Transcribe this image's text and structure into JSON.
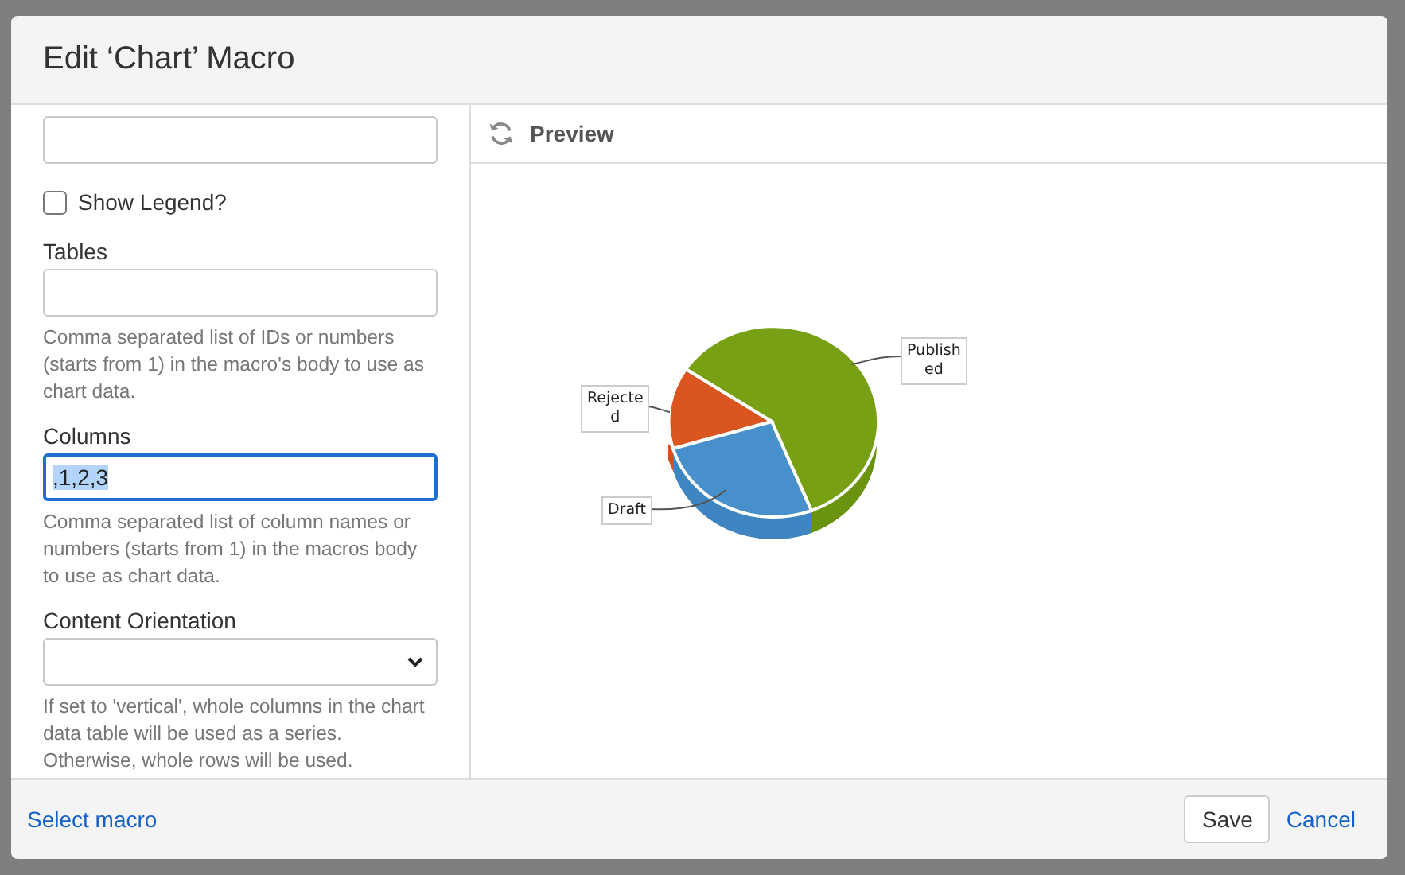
{
  "dialog": {
    "title": "Edit ‘Chart’ Macro"
  },
  "form": {
    "fields": [
      {
        "kind": "text",
        "focused": false
      },
      {
        "kind": "checkbox",
        "label": "Show Legend?",
        "checked": false
      },
      {
        "kind": "text",
        "label": "Tables",
        "focused": false,
        "help": "Comma separated list of IDs or numbers (starts from 1) in the macro's body to use as chart data."
      },
      {
        "kind": "text",
        "label": "Columns",
        "value": ",1,2,3",
        "focused": true,
        "text_selected": true,
        "help": "Comma separated list of column names or numbers (starts from 1) in the macros body to use as chart data."
      },
      {
        "kind": "select",
        "label": "Content Orientation",
        "help": "If set to 'vertical', whole columns in the chart data table will be used as a series. Otherwise, whole rows will be used."
      }
    ]
  },
  "preview": {
    "title": "Preview",
    "chart_labels": [
      {
        "lines": [
          "Publish",
          "ed"
        ]
      },
      {
        "lines": [
          "Rejecte",
          "d"
        ]
      },
      {
        "lines": [
          "Draft"
        ]
      }
    ]
  },
  "footer": {
    "link": "Select macro",
    "buttons": [
      {
        "label": "Save",
        "kind": "default"
      },
      {
        "label": "Cancel",
        "kind": "link"
      }
    ]
  }
}
